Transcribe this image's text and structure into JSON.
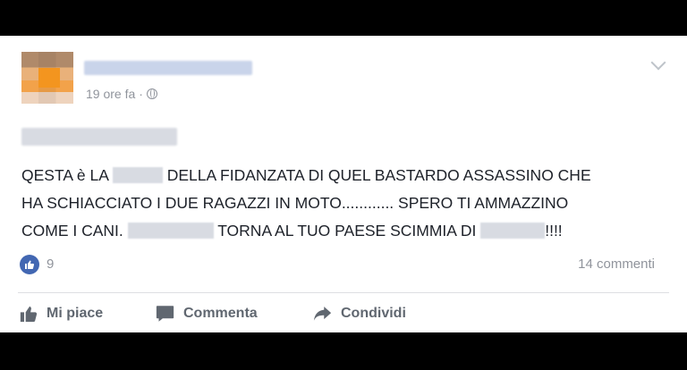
{
  "post": {
    "timestamp": "19 ore fa",
    "meta_separator": "·",
    "text": {
      "line1_a": "QESTA è LA",
      "line1_b": "DELLA FIDANZATA DI QUEL BASTARDO ASSASSINO CHE",
      "line2": "HA SCHIACCIATO I DUE RAGAZZI IN MOTO............ SPERO TI AMMAZZINO",
      "line3_a": "COME I CANI.",
      "line3_b": "TORNA AL TUO PAESE SCIMMIA DI",
      "line3_c": "!!!!"
    }
  },
  "stats": {
    "likes": "9",
    "comments": "14 commenti"
  },
  "actions": {
    "like": "Mi piace",
    "comment": "Comment​a",
    "share": "Condividi"
  },
  "colors": {
    "accent": "#4267b2",
    "muted_text": "#90949c",
    "action_text": "#606770",
    "background_bars": "#000000"
  },
  "icons": [
    "globe-icon",
    "chevron-down-icon",
    "like-reaction-icon",
    "thumbs-up-icon",
    "comment-icon",
    "share-icon"
  ]
}
